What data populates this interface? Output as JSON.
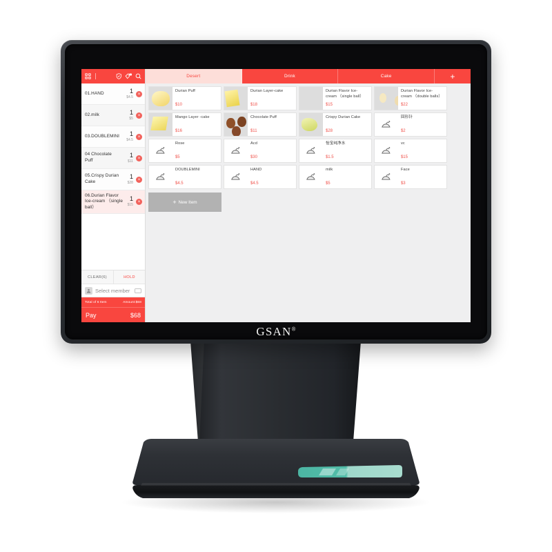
{
  "device": {
    "brand": "GSAN",
    "brand_mark": "®"
  },
  "cart": {
    "clear_label": "CLEAR(6)",
    "hold_label": "HOLD",
    "member_placeholder": "Select member",
    "total_items_label": "Total of 6 Item",
    "total_amount_label": "Amount:$68",
    "pay_label": "Pay",
    "pay_amount": "$68",
    "items": [
      {
        "index": "01.",
        "name": "HAND",
        "qty": "1",
        "price": "$4.5",
        "selected": false
      },
      {
        "index": "02.",
        "name": "milk",
        "qty": "1",
        "price": "$5",
        "selected": false
      },
      {
        "index": "03.",
        "name": "DOUBLEMINI",
        "qty": "1",
        "price": "$4.5",
        "selected": false
      },
      {
        "index": "04 ",
        "name": "Chocolate Puff",
        "qty": "1",
        "price": "$11",
        "selected": false
      },
      {
        "index": "05.",
        "name": "Crispy Durian Cake",
        "qty": "1",
        "price": "$28",
        "selected": false
      },
      {
        "index": "06.",
        "name": "Durian Flavor Ice-cream （single ball）",
        "qty": "1",
        "price": "$15",
        "selected": true
      }
    ],
    "delete_icon": "×"
  },
  "tabs": [
    {
      "label": "Desert",
      "active": true
    },
    {
      "label": "Drink",
      "active": false
    },
    {
      "label": "Cake",
      "active": false
    },
    {
      "label": "+",
      "active": false,
      "plus": true
    }
  ],
  "products": [
    {
      "name": "Durian Puff",
      "price": "$10",
      "thumb": "t-durianpuff"
    },
    {
      "name": "Durian Layer-cake",
      "price": "$18",
      "thumb": "t-layercake"
    },
    {
      "name": "Durian Flavor Ice-cream （single ball）",
      "price": "$15",
      "thumb": "t-icecream1"
    },
    {
      "name": "Durian Flavor Ice-cream （double balls）",
      "price": "$22",
      "thumb": "t-icecream2"
    },
    {
      "name": "Mango  Layer -cake",
      "price": "$16",
      "thumb": "t-mangocake"
    },
    {
      "name": "Chocolate Puff",
      "price": "$11",
      "thumb": "t-chocpuff"
    },
    {
      "name": "Crispy Durian Cake",
      "price": "$28",
      "thumb": "t-crispy"
    },
    {
      "name": "回形针",
      "price": "$2",
      "thumb": ""
    },
    {
      "name": "Rose",
      "price": "$5",
      "thumb": ""
    },
    {
      "name": "Acd",
      "price": "$30",
      "thumb": ""
    },
    {
      "name": "怡宝纯净水",
      "price": "$1.5",
      "thumb": ""
    },
    {
      "name": "vc",
      "price": "$15",
      "thumb": ""
    },
    {
      "name": "DOUBLEMINI",
      "price": "$4.5",
      "thumb": ""
    },
    {
      "name": "HAND",
      "price": "$4.5",
      "thumb": ""
    },
    {
      "name": "milk",
      "price": "$5",
      "thumb": ""
    },
    {
      "name": "Face",
      "price": "$3",
      "thumb": ""
    }
  ],
  "new_item": {
    "plus": "+",
    "label": "New Item"
  },
  "colors": {
    "accent_red": "#f9463f",
    "price_red": "#f0524b",
    "tab_active_bg": "#fdded9",
    "screen_bg": "#efeff0",
    "new_item_bg": "#b2b2b2",
    "base_sticker_teal": "#52bda8"
  }
}
